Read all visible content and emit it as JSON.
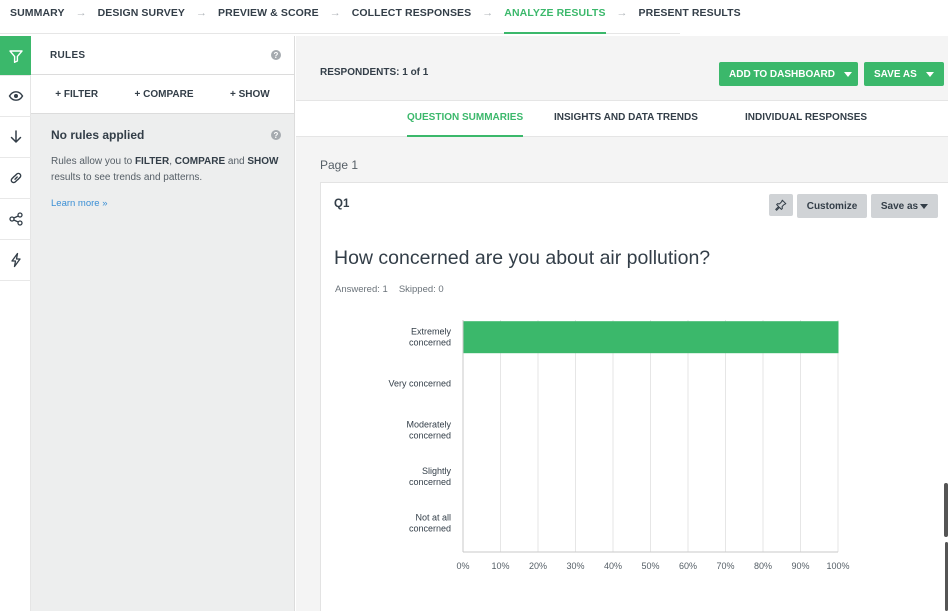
{
  "nav": {
    "steps": [
      {
        "label": "SUMMARY",
        "active": false
      },
      {
        "label": "DESIGN SURVEY",
        "active": false
      },
      {
        "label": "PREVIEW & SCORE",
        "active": false
      },
      {
        "label": "COLLECT RESPONSES",
        "active": false
      },
      {
        "label": "ANALYZE RESULTS",
        "active": true
      },
      {
        "label": "PRESENT RESULTS",
        "active": false
      }
    ]
  },
  "rail": {
    "icons": [
      "filter-icon",
      "eye-icon",
      "download-icon",
      "link-icon",
      "share-icon",
      "lightning-icon"
    ]
  },
  "rules": {
    "title": "RULES",
    "help": "?",
    "actions": [
      "+ FILTER",
      "+ COMPARE",
      "+ SHOW"
    ],
    "empty_title": "No rules applied",
    "desc_pre": "Rules allow you to ",
    "desc_filter": "FILTER",
    "desc_sep1": ", ",
    "desc_compare": "COMPARE",
    "desc_and": " and ",
    "desc_show": "SHOW",
    "desc_post": " results to see trends and patterns.",
    "learn_more": "Learn more »"
  },
  "main": {
    "respondents": "RESPONDENTS: 1 of 1",
    "add_to_dashboard": "ADD TO DASHBOARD",
    "save_as": "SAVE AS",
    "tabs": [
      {
        "label": "QUESTION SUMMARIES",
        "active": true
      },
      {
        "label": "INSIGHTS AND DATA TRENDS",
        "active": false
      },
      {
        "label": "INDIVIDUAL RESPONSES",
        "active": false
      }
    ],
    "page_label": "Page 1"
  },
  "question": {
    "id": "Q1",
    "customize": "Customize",
    "save_as": "Save as",
    "text": "How concerned are you about air pollution?",
    "answered": "Answered: 1",
    "skipped": "Skipped: 0"
  },
  "colors": {
    "accent": "#3bb86b",
    "grid": "#e6e6e6",
    "axis": "#c9c9c9"
  },
  "chart_data": {
    "type": "bar",
    "orientation": "horizontal",
    "categories": [
      [
        "Extremely",
        "concerned"
      ],
      [
        "Very concerned"
      ],
      [
        "Moderately",
        "concerned"
      ],
      [
        "Slightly",
        "concerned"
      ],
      [
        "Not at all",
        "concerned"
      ]
    ],
    "values": [
      100,
      0,
      0,
      0,
      0
    ],
    "xlim": [
      0,
      100
    ],
    "xticks": [
      "0%",
      "10%",
      "20%",
      "30%",
      "40%",
      "50%",
      "60%",
      "70%",
      "80%",
      "90%",
      "100%"
    ],
    "grid": true
  }
}
